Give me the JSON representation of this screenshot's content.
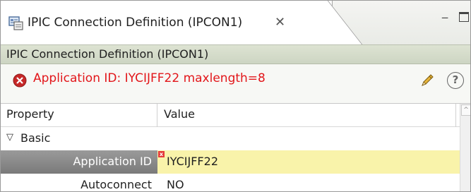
{
  "tab": {
    "title": "IPIC Connection Definition (IPCON1)",
    "close_glyph": "✕",
    "icon": "definition-icon"
  },
  "window_controls": {
    "minimize_glyph": "‒",
    "maximize_icon": "maximize-icon"
  },
  "header": {
    "title": "IPIC Connection Definition (IPCON1)"
  },
  "error": {
    "icon": "error-icon",
    "message": "Application ID: IYCIJFF22 maxlength=8",
    "color": "#e2161a"
  },
  "toolbar": {
    "edit_icon": "pencil-icon",
    "help_glyph": "?"
  },
  "table": {
    "columns": [
      "Property",
      "Value"
    ],
    "group": {
      "toggle_glyph": "▽",
      "label": "Basic"
    },
    "rows": [
      {
        "property": "Application ID",
        "value": "IYCIJFF22",
        "selected": true,
        "error_marker": "x"
      },
      {
        "property": "Autoconnect",
        "value": "NO",
        "selected": false
      }
    ]
  },
  "scrollbar": {
    "up_glyph": "^"
  },
  "colors": {
    "selected_value_bg": "#f9f3aa",
    "selected_property_bg": "#8a8a8a",
    "header_bg": "#d5dccb"
  }
}
